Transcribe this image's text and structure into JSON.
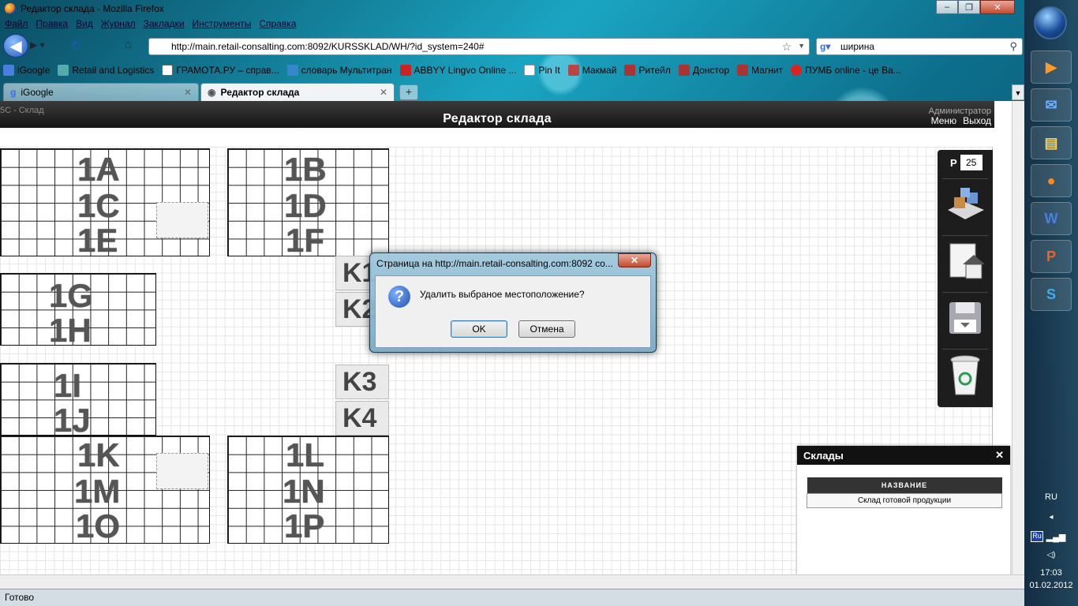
{
  "window": {
    "title": "Редактор склада - Mozilla Firefox",
    "min": "▭",
    "max": "▭",
    "close": "✕"
  },
  "menu": [
    "Файл",
    "Правка",
    "Вид",
    "Журнал",
    "Закладки",
    "Инструменты",
    "Справка"
  ],
  "nav": {
    "url": "http://main.retail-consalting.com:8092/KURSSKLAD/WH/?id_system=240#",
    "search": "ширина"
  },
  "bookmarks": [
    "iGoogle",
    "Retail and Logistics",
    "ГРАМОТА.РУ – справ...",
    "словарь Мультитран",
    "ABBYY Lingvo Online ...",
    "Pin It",
    "Макмай",
    "Ритейл",
    "Донстор",
    "Магнит",
    "ПУМБ online - це Ва..."
  ],
  "tabs": [
    {
      "label": "iGoogle"
    },
    {
      "label": "Редактор склада"
    }
  ],
  "app": {
    "crumb": "5C - Склад",
    "title": "Редактор склада",
    "user": "Администратор",
    "menu": "Меню",
    "exit": "Выход"
  },
  "blocks": [
    "1A",
    "1B",
    "1C",
    "1D",
    "1E",
    "1F",
    "1G",
    "1H",
    "1I",
    "1J",
    "1K",
    "1L",
    "1M",
    "1N",
    "1O",
    "1P"
  ],
  "kcells": [
    "K1",
    "K2",
    "K3",
    "K4"
  ],
  "tools": {
    "p_label": "P",
    "p_value": "25"
  },
  "warehouses": {
    "title": "Склады",
    "col": "НАЗВАНИЕ",
    "rows": [
      "Склад готовой продукции"
    ]
  },
  "dialog": {
    "title": "Страница на http://main.retail-consalting.com:8092 co...",
    "message": "Удалить выбраное местоположение?",
    "ok": "OK",
    "cancel": "Отмена"
  },
  "status": "Готово",
  "taskbar": {
    "lang": "RU",
    "kbd": "Ru",
    "time": "17:03",
    "date": "01.02.2012"
  }
}
